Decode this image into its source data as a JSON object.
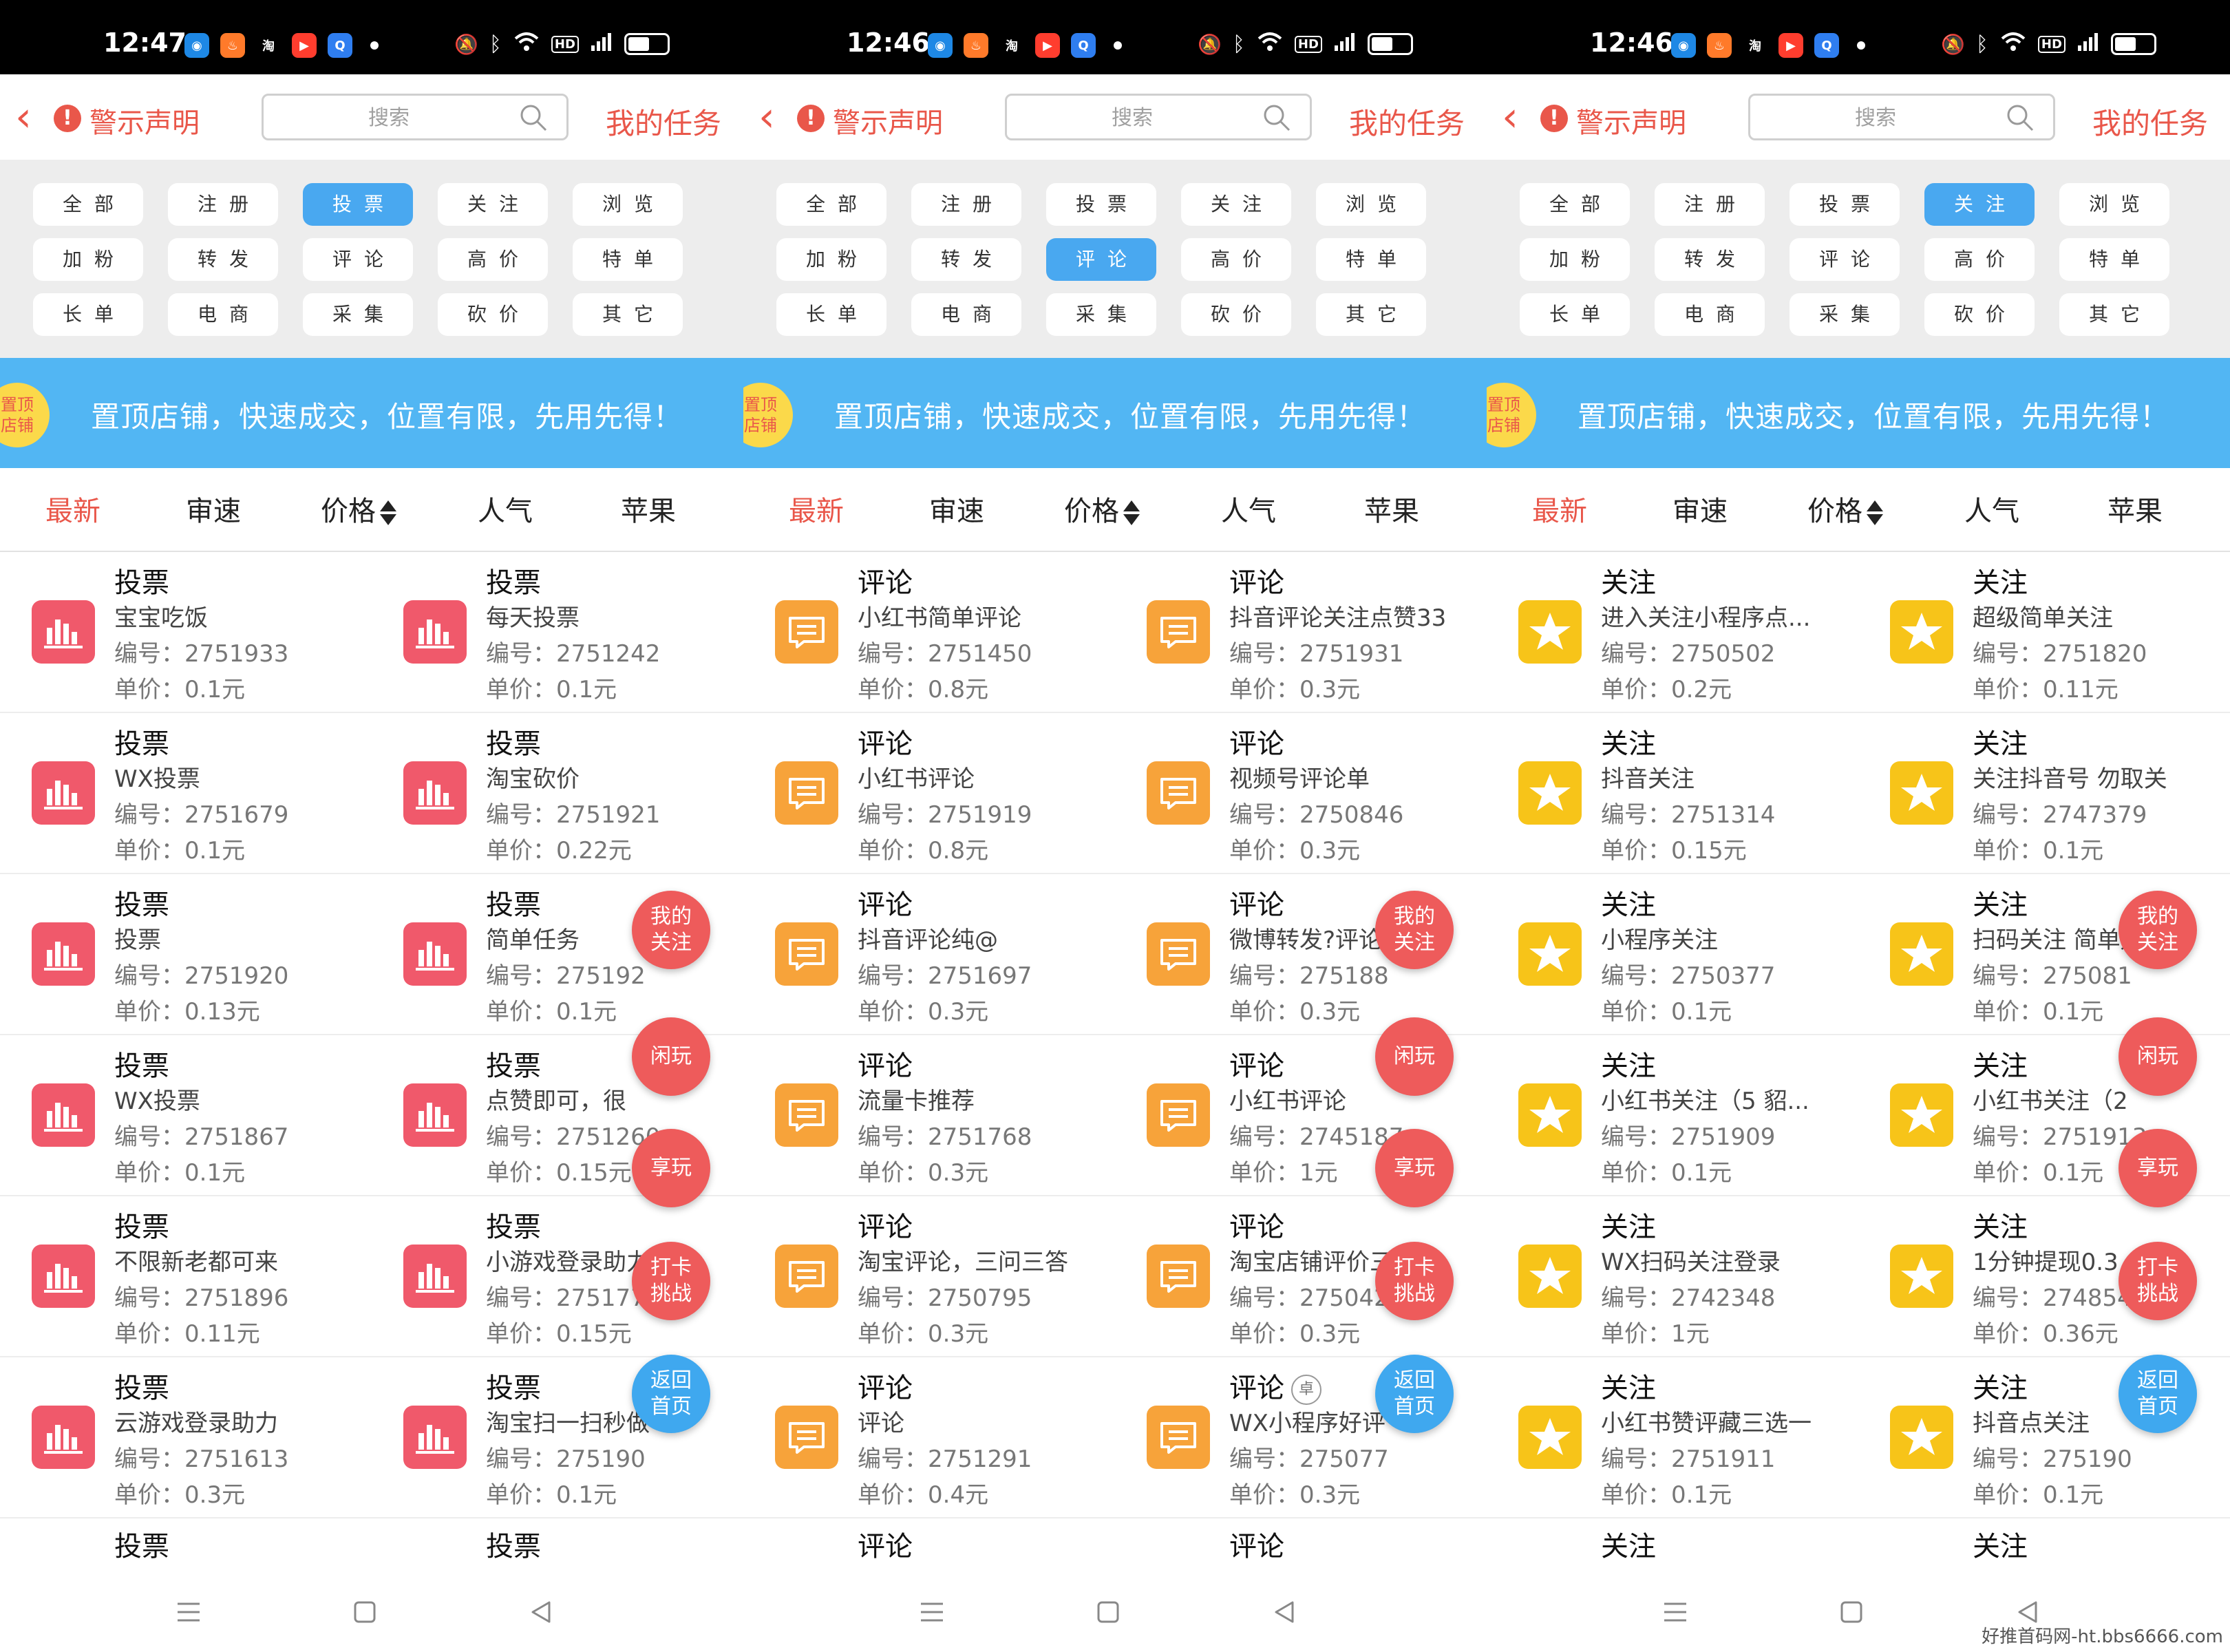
{
  "screens": [
    {
      "status": {
        "time": "12:47"
      },
      "nav": {
        "warning_label": "警示声明",
        "search_placeholder": "搜索",
        "my_tasks": "我的任务"
      },
      "categories": [
        "全部",
        "注册",
        "投票",
        "关注",
        "浏览",
        "加粉",
        "转发",
        "评论",
        "高价",
        "特单",
        "长单",
        "电商",
        "采集",
        "砍价",
        "其它"
      ],
      "active_category": "投票",
      "banner": {
        "badge_line1": "置顶",
        "badge_line2": "店铺",
        "text": "置顶店铺，快速成交，位置有限，先用先得！"
      },
      "sort": [
        "最新",
        "审速",
        "价格",
        "人气",
        "苹果"
      ],
      "active_sort": "最新",
      "icon": "bar-chart-icon",
      "rows": [
        [
          {
            "title": "投票",
            "name": "宝宝吃饭",
            "id": "编号：2751933",
            "price": "单价：0.1元"
          },
          {
            "title": "投票",
            "name": "每天投票",
            "id": "编号：2751242",
            "price": "单价：0.1元"
          }
        ],
        [
          {
            "title": "投票",
            "name": "WX投票",
            "id": "编号：2751679",
            "price": "单价：0.1元"
          },
          {
            "title": "投票",
            "name": "淘宝砍价",
            "id": "编号：2751921",
            "price": "单价：0.22元"
          }
        ],
        [
          {
            "title": "投票",
            "name": "投票",
            "id": "编号：2751920",
            "price": "单价：0.13元"
          },
          {
            "title": "投票",
            "name": "简单任务",
            "id": "编号：275192",
            "price": "单价：0.1元"
          }
        ],
        [
          {
            "title": "投票",
            "name": "WX投票",
            "id": "编号：2751867",
            "price": "单价：0.1元"
          },
          {
            "title": "投票",
            "name": "点赞即可，很",
            "id": "编号：2751260",
            "price": "单价：0.15元"
          }
        ],
        [
          {
            "title": "投票",
            "name": "不限新老都可来",
            "id": "编号：2751896",
            "price": "单价：0.11元"
          },
          {
            "title": "投票",
            "name": "小游戏登录助力",
            "id": "编号：2751773",
            "price": "单价：0.15元"
          }
        ],
        [
          {
            "title": "投票",
            "name": "云游戏登录助力",
            "id": "编号：2751613",
            "price": "单价：0.3元"
          },
          {
            "title": "投票",
            "name": "淘宝扫一扫秒做",
            "id": "编号：275190",
            "price": "单价：0.1元"
          }
        ]
      ],
      "partial_titles": [
        "投票",
        "投票"
      ]
    },
    {
      "status": {
        "time": "12:46"
      },
      "nav": {
        "warning_label": "警示声明",
        "search_placeholder": "搜索",
        "my_tasks": "我的任务"
      },
      "categories": [
        "全部",
        "注册",
        "投票",
        "关注",
        "浏览",
        "加粉",
        "转发",
        "评论",
        "高价",
        "特单",
        "长单",
        "电商",
        "采集",
        "砍价",
        "其它"
      ],
      "active_category": "评论",
      "banner": {
        "badge_line1": "置顶",
        "badge_line2": "店铺",
        "text": "置顶店铺，快速成交，位置有限，先用先得！"
      },
      "sort": [
        "最新",
        "审速",
        "价格",
        "人气",
        "苹果"
      ],
      "active_sort": "最新",
      "icon": "comment-icon",
      "rows": [
        [
          {
            "title": "评论",
            "name": "小红书简单评论",
            "id": "编号：2751450",
            "price": "单价：0.8元"
          },
          {
            "title": "评论",
            "name": "抖音评论关注点赞33",
            "id": "编号：2751931",
            "price": "单价：0.3元"
          }
        ],
        [
          {
            "title": "评论",
            "name": "小红书评论",
            "id": "编号：2751919",
            "price": "单价：0.8元"
          },
          {
            "title": "评论",
            "name": "视频号评论单",
            "id": "编号：2750846",
            "price": "单价：0.3元"
          }
        ],
        [
          {
            "title": "评论",
            "name": "抖音评论纯@",
            "id": "编号：2751697",
            "price": "单价：0.3元"
          },
          {
            "title": "评论",
            "name": "微博转发?评论,",
            "id": "编号：275188",
            "price": "单价：0.3元"
          }
        ],
        [
          {
            "title": "评论",
            "name": "流量卡推荐",
            "id": "编号：2751768",
            "price": "单价：0.3元"
          },
          {
            "title": "评论",
            "name": "小红书评论",
            "id": "编号：2745187",
            "price": "单价：1元"
          }
        ],
        [
          {
            "title": "评论",
            "name": "淘宝评论，三问三答",
            "id": "编号：2750795",
            "price": "单价：0.3元"
          },
          {
            "title": "评论",
            "name": "淘宝店铺评价三问...",
            "id": "编号：2750427",
            "price": "单价：0.3元"
          }
        ],
        [
          {
            "title": "评论",
            "name": "评论",
            "id": "编号：2751291",
            "price": "单价：0.4元"
          },
          {
            "title": "评论",
            "name": "WX小程序好评",
            "id": "编号：275077",
            "price": "单价：0.3元",
            "badge": "卓"
          }
        ]
      ],
      "partial_titles": [
        "评论",
        "评论"
      ]
    },
    {
      "status": {
        "time": "12:46"
      },
      "nav": {
        "warning_label": "警示声明",
        "search_placeholder": "搜索",
        "my_tasks": "我的任务"
      },
      "categories": [
        "全部",
        "注册",
        "投票",
        "关注",
        "浏览",
        "加粉",
        "转发",
        "评论",
        "高价",
        "特单",
        "长单",
        "电商",
        "采集",
        "砍价",
        "其它"
      ],
      "active_category": "关注",
      "banner": {
        "badge_line1": "置顶",
        "badge_line2": "店铺",
        "text": "置顶店铺，快速成交，位置有限，先用先得！"
      },
      "sort": [
        "最新",
        "审速",
        "价格",
        "人气",
        "苹果"
      ],
      "active_sort": "最新",
      "icon": "star-icon",
      "rows": [
        [
          {
            "title": "关注",
            "name": "进入关注小程序点...",
            "id": "编号：2750502",
            "price": "单价：0.2元"
          },
          {
            "title": "关注",
            "name": "超级简单关注",
            "id": "编号：2751820",
            "price": "单价：0.11元"
          }
        ],
        [
          {
            "title": "关注",
            "name": "抖音关注",
            "id": "编号：2751314",
            "price": "单价：0.15元"
          },
          {
            "title": "关注",
            "name": "关注抖音号 勿取关",
            "id": "编号：2747379",
            "price": "单价：0.1元"
          }
        ],
        [
          {
            "title": "关注",
            "name": "小程序关注",
            "id": "编号：2750377",
            "price": "单价：0.1元"
          },
          {
            "title": "关注",
            "name": "扫码关注 简单好做",
            "id": "编号：275081",
            "price": "单价：0.1元"
          }
        ],
        [
          {
            "title": "关注",
            "name": "小红书关注（5 貂...",
            "id": "编号：2751909",
            "price": "单价：0.1元"
          },
          {
            "title": "关注",
            "name": "小红书关注（2",
            "id": "编号：2751913",
            "price": "单价：0.1元"
          }
        ],
        [
          {
            "title": "关注",
            "name": "WX扫码关注登录",
            "id": "编号：2742348",
            "price": "单价：1元"
          },
          {
            "title": "关注",
            "name": "1分钟提现0.3",
            "id": "编号：2748541",
            "price": "单价：0.36元"
          }
        ],
        [
          {
            "title": "关注",
            "name": "小红书赞评藏三选一",
            "id": "编号：2751911",
            "price": "单价：0.1元"
          },
          {
            "title": "关注",
            "name": "抖音点关注",
            "id": "编号：275190",
            "price": "单价：0.1元"
          }
        ]
      ],
      "partial_titles": [
        "关注",
        "关注"
      ]
    }
  ],
  "fabs": [
    {
      "label": "我的\n关注",
      "color": "red"
    },
    {
      "label": "闲玩",
      "color": "red"
    },
    {
      "label": "享玩",
      "color": "red"
    },
    {
      "label": "打卡\n挑战",
      "color": "red"
    },
    {
      "label": "返回\n首页",
      "color": "blue"
    }
  ],
  "status_icons": {
    "hd": "HD",
    "signal": "5G"
  },
  "status_apps": [
    {
      "glyph": "◉",
      "color": "#1e88e5"
    },
    {
      "glyph": "♨",
      "color": "#ff7a2a"
    },
    {
      "glyph": "淘",
      "color": "#000000"
    },
    {
      "glyph": "▶",
      "color": "#ff3d2e"
    },
    {
      "glyph": "Q",
      "color": "#2f7ef0"
    }
  ],
  "battery_level": 0.62,
  "colors": {
    "accent_red": "#e9574a",
    "active_blue": "#49a8f0",
    "banner_blue": "#52b6f3",
    "vote_icon": "#f0596b",
    "comment_icon": "#f7a33a",
    "star_icon": "#f7c419"
  },
  "watermark": "好推首码网-ht.bbs6666.com"
}
